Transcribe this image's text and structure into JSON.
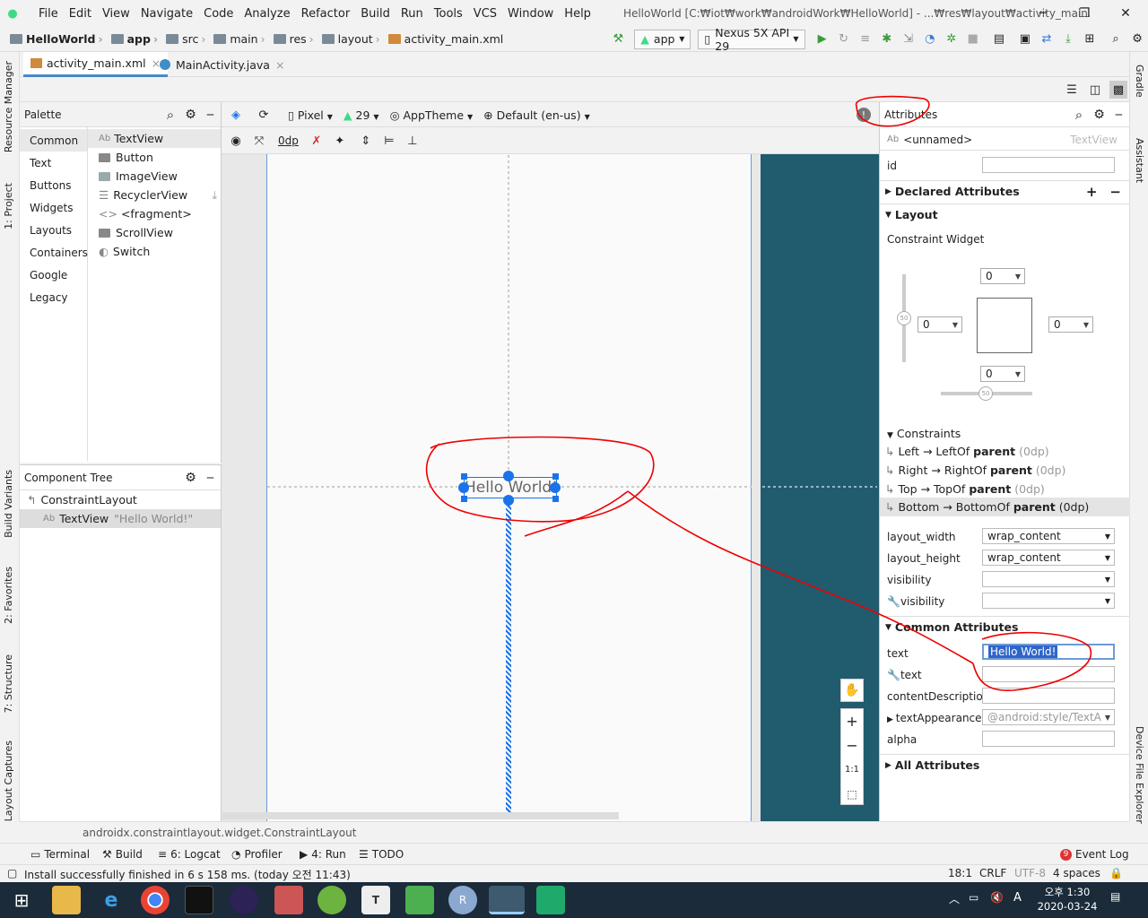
{
  "menu": [
    "File",
    "Edit",
    "View",
    "Navigate",
    "Code",
    "Analyze",
    "Refactor",
    "Build",
    "Run",
    "Tools",
    "VCS",
    "Window",
    "Help"
  ],
  "window_title": "HelloWorld [C:₩iot₩work₩androidWork₩HelloWorld] - ...₩res₩layout₩activity_main.xml [app]",
  "breadcrumbs": [
    "HelloWorld",
    "app",
    "src",
    "main",
    "res",
    "layout",
    "activity_main.xml"
  ],
  "run_config": "app",
  "device": "Nexus 5X API 29",
  "editor_tabs": [
    "activity_main.xml",
    "MainActivity.java"
  ],
  "left_tool_tabs": [
    "Resource Manager",
    "1: Project",
    "Build Variants",
    "2: Favorites",
    "7: Structure",
    "Layout Captures"
  ],
  "right_tool_tabs": [
    "Gradle",
    "Assistant",
    "Device File Explorer"
  ],
  "palette": {
    "title": "Palette",
    "categories": [
      "Common",
      "Text",
      "Buttons",
      "Widgets",
      "Layouts",
      "Containers",
      "Google",
      "Legacy"
    ],
    "items": [
      "TextView",
      "Button",
      "ImageView",
      "RecyclerView",
      "<fragment>",
      "ScrollView",
      "Switch"
    ]
  },
  "component_tree": {
    "title": "Component Tree",
    "root": "ConstraintLayout",
    "child": "TextView",
    "child_text": "\"Hello World!\""
  },
  "design_toolbar": {
    "device": "Pixel",
    "api": "29",
    "theme": "AppTheme",
    "locale": "Default (en-us)",
    "margin": "0dp"
  },
  "canvas": {
    "text": "Hello World!",
    "zoom_ratio": "1:1"
  },
  "attributes": {
    "title": "Attributes",
    "component_name": "<unnamed>",
    "component_type": "TextView",
    "id_label": "id",
    "declared": "Declared Attributes",
    "layout": "Layout",
    "constraint_widget": "Constraint Widget",
    "margins": {
      "top": "0",
      "left": "0",
      "right": "0",
      "bottom": "0"
    },
    "bias": "50",
    "constraints_label": "Constraints",
    "constraints": [
      {
        "side": "Left",
        "to": "LeftOf",
        "target": "parent",
        "dp": "(0dp)"
      },
      {
        "side": "Right",
        "to": "RightOf",
        "target": "parent",
        "dp": "(0dp)"
      },
      {
        "side": "Top",
        "to": "TopOf",
        "target": "parent",
        "dp": "(0dp)"
      },
      {
        "side": "Bottom",
        "to": "BottomOf",
        "target": "parent",
        "dp": "(0dp)"
      }
    ],
    "layout_width_label": "layout_width",
    "layout_width": "wrap_content",
    "layout_height_label": "layout_height",
    "layout_height": "wrap_content",
    "visibility_label": "visibility",
    "tools_visibility_label": "visibility",
    "common": "Common Attributes",
    "text_label": "text",
    "text_value": "Hello World!",
    "tools_text_label": "text",
    "content_description_label": "contentDescription",
    "text_appearance_label": "textAppearance",
    "text_appearance": "@android:style/TextA",
    "alpha_label": "alpha",
    "all": "All Attributes"
  },
  "path_bar": "androidx.constraintlayout.widget.ConstraintLayout",
  "bottom_tabs": [
    "Terminal",
    "Build",
    "6: Logcat",
    "Profiler",
    "4: Run",
    "TODO"
  ],
  "event_log": "Event Log",
  "event_count": "9",
  "status_message": "Install successfully finished in 6 s 158 ms. (today 오전 11:43)",
  "status_right": {
    "pos": "18:1",
    "eol": "CRLF",
    "enc": "UTF-8",
    "indent": "4 spaces"
  },
  "clock": {
    "time": "오후 1:30",
    "date": "2020-03-24"
  },
  "ime": "A",
  "colors": {
    "accent": "#1a73e8",
    "blueprint": "#215b6e",
    "annotation": "#e00000"
  }
}
